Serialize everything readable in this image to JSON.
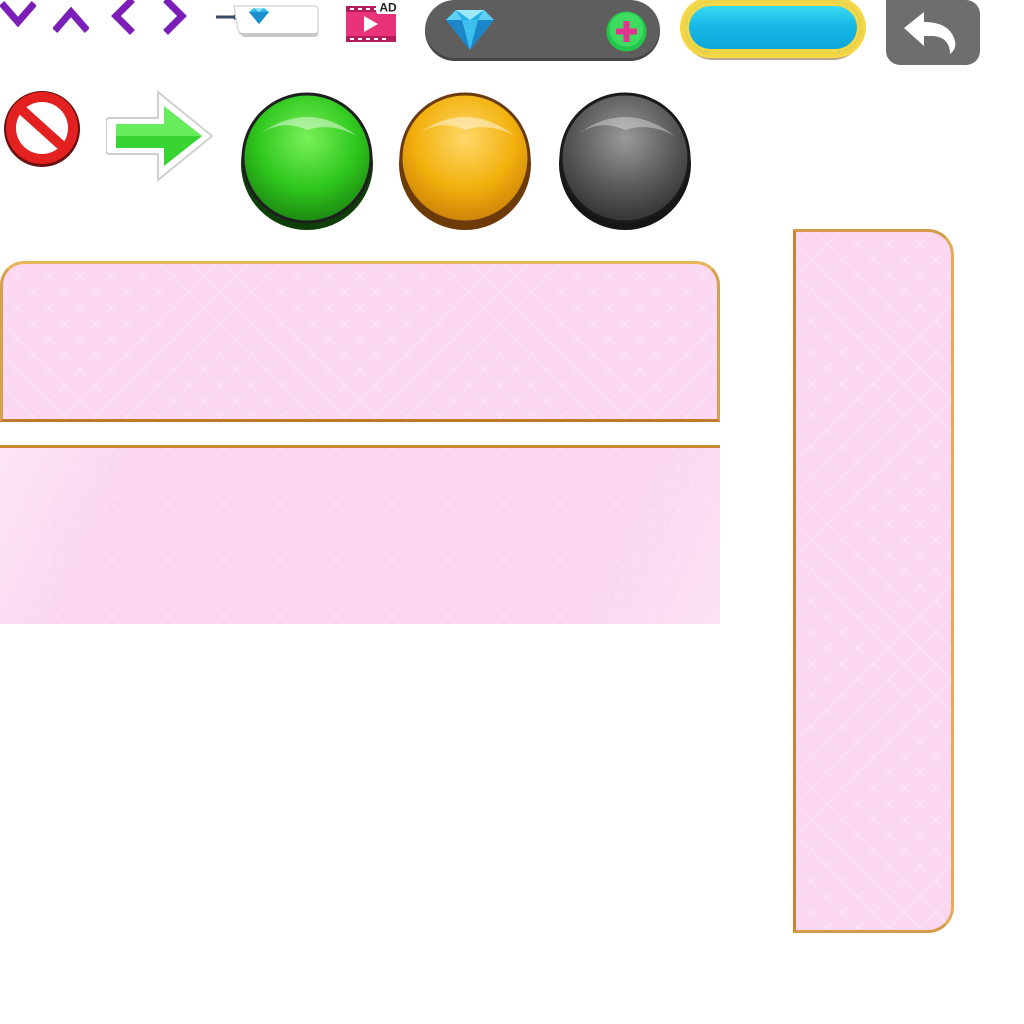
{
  "toolbar": {
    "icons": [
      "chevron-down-icon",
      "chevron-up-icon",
      "chevron-left-icon",
      "chevron-right-icon",
      "gem-tag-icon",
      "ad-video-icon"
    ],
    "accent_purple": "#7b1fb8"
  },
  "gem_bar": {
    "value": "",
    "icons": [
      "gem-icon",
      "plus-icon"
    ],
    "bg_color": "#5e5e5e",
    "plus_color": "#22c84a"
  },
  "blue_button": {
    "label": "",
    "color": "#17b9e6",
    "border_color": "#f0d447"
  },
  "back_button": {
    "icon": "back-arrow-icon",
    "bg_color": "#6e6e6e"
  },
  "row2": {
    "icons": [
      "no-entry-icon",
      "arrow-right-icon"
    ],
    "orbs": [
      {
        "name": "green-orb",
        "color": "#3fcf1a"
      },
      {
        "name": "yellow-orb",
        "color": "#f2b10d"
      },
      {
        "name": "gray-orb",
        "color": "#5a5a5a"
      }
    ]
  },
  "panels": {
    "fill_color": "#fbd7f1",
    "border_color": "#d6a04c"
  }
}
